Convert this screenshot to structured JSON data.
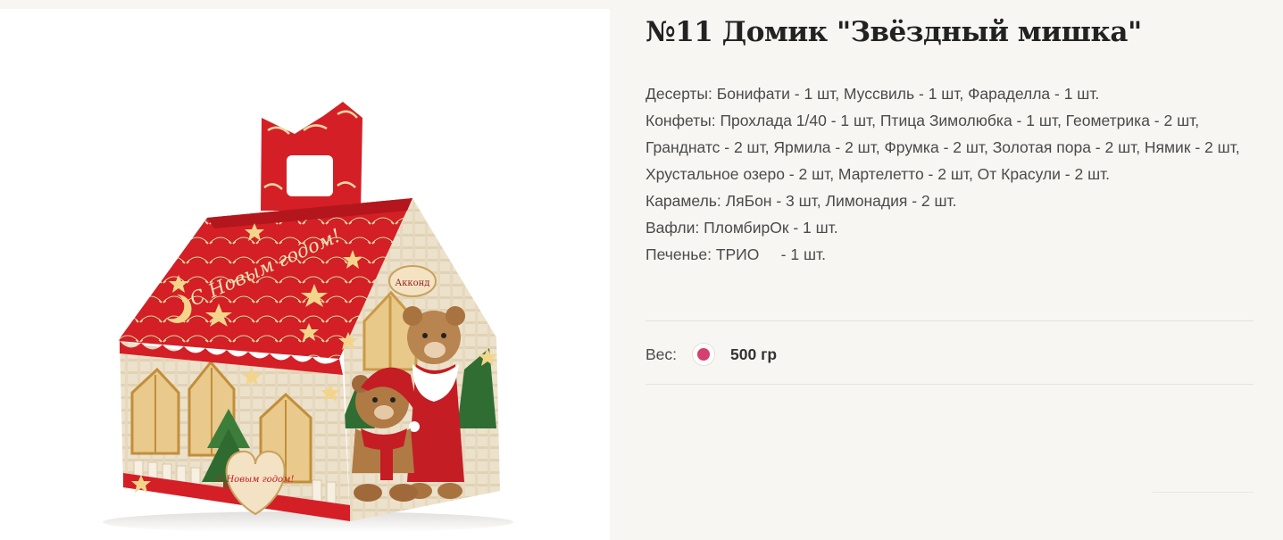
{
  "product": {
    "title": "№11 Домик \"Звёздный мишка\"",
    "image_alt": "Подарочная коробка «Звёздный мишка»",
    "box_text": {
      "roof": "С Новым годом!",
      "logo": "Акконд",
      "heart": "С Новым годом!"
    },
    "description": [
      "Десерты: Бонифати - 1 шт, Муссвиль - 1 шт, Фараделла - 1 шт.",
      "Конфеты: Прохлада 1/40 - 1 шт, Птица Зимолюбка - 1 шт, Геометрика - 2 шт, Гранднатс - 2 шт, Ярмила - 2 шт, Фрумка - 2 шт, Золотая пора - 2 шт, Нямик - 2 шт, Хрустальное озеро - 2 шт, Мартелетто - 2 шт, От Красули - 2 шт.",
      "Карамель: ЛяБон - 3 шт, Лимонадия - 2 шт.",
      "Вафли: ПломбирОк - 1 шт.",
      "Печенье: ТРИО     - 1 шт."
    ],
    "weight": {
      "label": "Вес:",
      "value": "500 гр",
      "swatch_color": "#d6406f"
    }
  },
  "colors": {
    "background": "#f7f6f3",
    "accent": "#d6406f",
    "box_red": "#d41f26",
    "divider": "#e6e3de"
  }
}
